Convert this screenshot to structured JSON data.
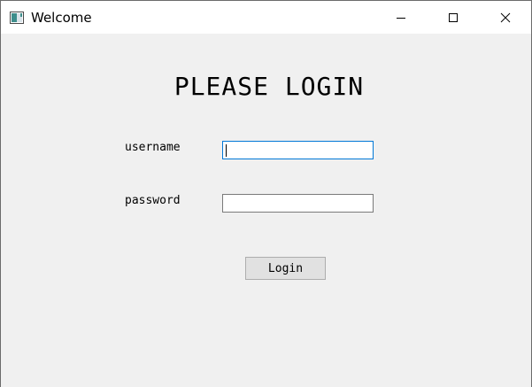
{
  "window": {
    "title": "Welcome",
    "icon": "app-window-icon",
    "controls": {
      "minimize_icon": "minimize-icon",
      "maximize_icon": "maximize-icon",
      "close_icon": "close-icon"
    }
  },
  "form": {
    "heading": "PLEASE LOGIN",
    "username_label": "username",
    "username_value": "",
    "password_label": "password",
    "password_value": "",
    "login_label": "Login"
  },
  "colors": {
    "focus_border": "#0078d7",
    "window_background": "#f0f0f0",
    "titlebar_background": "#ffffff",
    "button_background": "#e1e1e1"
  }
}
